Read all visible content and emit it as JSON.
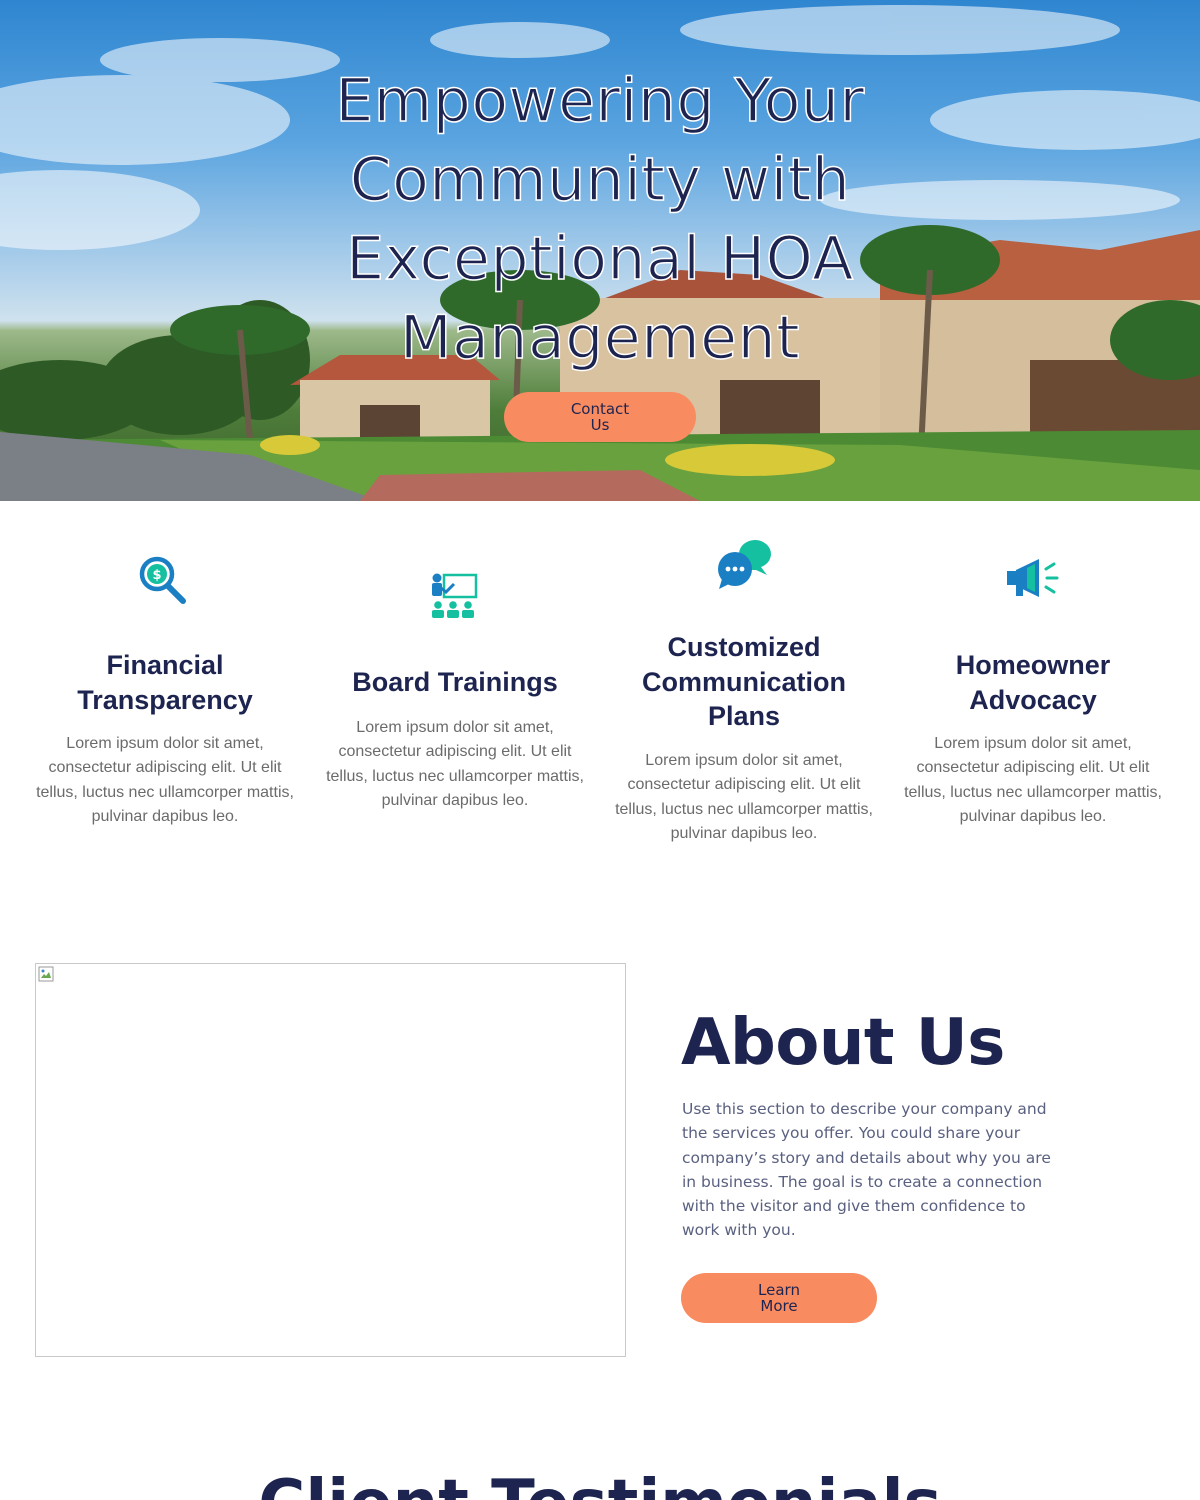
{
  "hero": {
    "title": "Empowering Your Community with Exceptional HOA Management",
    "contact_label": "Contact Us"
  },
  "features": [
    {
      "icon": "dollar-magnifier-icon",
      "title": "Financial Transparency",
      "text": "Lorem ipsum dolor sit amet, consectetur adipiscing elit. Ut elit tellus, luctus nec ullamcorper mattis, pulvinar dapibus leo."
    },
    {
      "icon": "presentation-training-icon",
      "title": "Board Trainings",
      "text": "Lorem ipsum dolor sit amet, consectetur adipiscing elit. Ut elit tellus, luctus nec ullamcorper mattis, pulvinar dapibus leo."
    },
    {
      "icon": "chat-bubbles-icon",
      "title": "Customized Communication Plans",
      "text": "Lorem ipsum dolor sit amet, consectetur adipiscing elit. Ut elit tellus, luctus nec ullamcorper mattis, pulvinar dapibus leo."
    },
    {
      "icon": "megaphone-icon",
      "title": "Homeowner Advocacy",
      "text": "Lorem ipsum dolor sit amet, consectetur adipiscing elit. Ut elit tellus, luctus nec ullamcorper mattis, pulvinar dapibus leo."
    }
  ],
  "about": {
    "title": "About Us",
    "text": "Use this section to describe your company and the services you offer. You could share your company’s story and details about why you are in business. The goal is to create a connection with the visitor and give them confidence to work with you.",
    "button_label": "Learn More"
  },
  "testimonials": {
    "title": "Client Testimonials"
  },
  "colors": {
    "navy": "#1e2450",
    "accent_orange": "#f98b60",
    "icon_blue": "#1b7fc4",
    "icon_teal": "#14c0a0"
  }
}
